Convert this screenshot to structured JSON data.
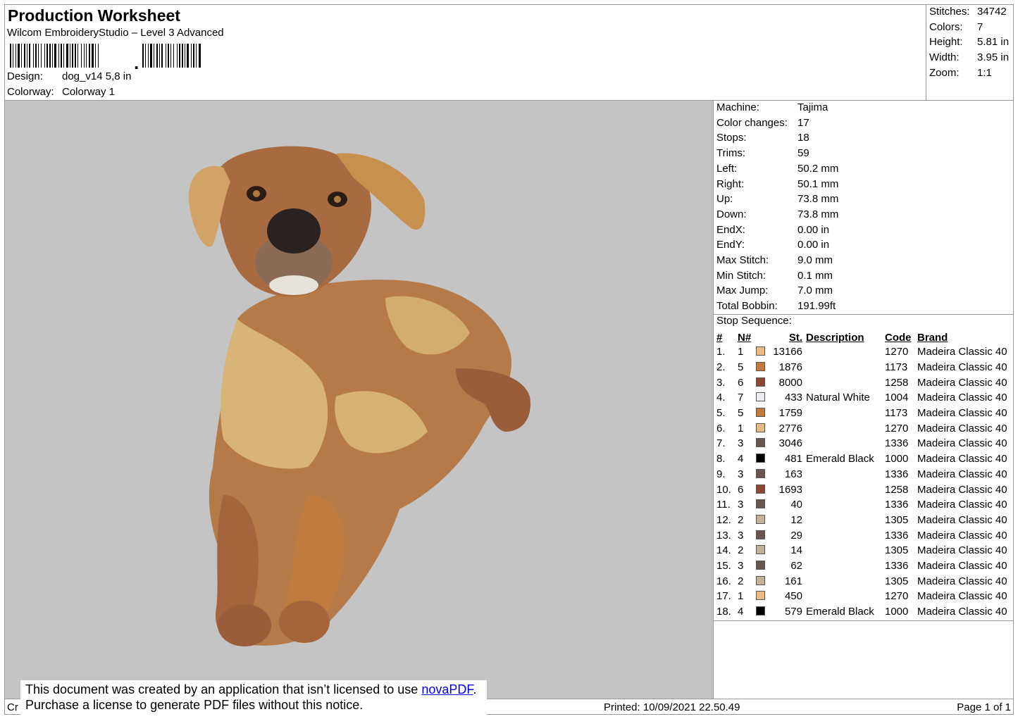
{
  "header": {
    "title": "Production Worksheet",
    "software": "Wilcom EmbroideryStudio – Level 3 Advanced",
    "barcode_digits": ",",
    "design_label": "Design:",
    "design_value": "dog_v14 5,8 in",
    "colorway_label": "Colorway:",
    "colorway_value": "Colorway 1"
  },
  "summary": {
    "stitches_label": "Stitches:",
    "stitches_value": "34742",
    "colors_label": "Colors:",
    "colors_value": "7",
    "height_label": "Height:",
    "height_value": "5.81 in",
    "width_label": "Width:",
    "width_value": "3.95 in",
    "zoom_label": "Zoom:",
    "zoom_value": "1:1"
  },
  "machine_info": [
    {
      "label": "Machine:",
      "value": "Tajima"
    },
    {
      "label": "Color changes:",
      "value": "17"
    },
    {
      "label": "Stops:",
      "value": "18"
    },
    {
      "label": "Trims:",
      "value": "59"
    },
    {
      "label": "Left:",
      "value": "50.2 mm"
    },
    {
      "label": "Right:",
      "value": "50.1 mm"
    },
    {
      "label": "Up:",
      "value": "73.8 mm"
    },
    {
      "label": "Down:",
      "value": "73.8 mm"
    },
    {
      "label": "EndX:",
      "value": "0.00 in"
    },
    {
      "label": "EndY:",
      "value": "0.00 in"
    },
    {
      "label": "Max Stitch:",
      "value": "9.0 mm"
    },
    {
      "label": "Min Stitch:",
      "value": "0.1 mm"
    },
    {
      "label": "Max Jump:",
      "value": "7.0 mm"
    },
    {
      "label": "Total Bobbin:",
      "value": "191.99ft"
    }
  ],
  "stop_sequence": {
    "title": "Stop Sequence:",
    "columns": [
      "#",
      "N#",
      "St.",
      "Description",
      "Code",
      "Brand"
    ],
    "rows": [
      {
        "idx": "1.",
        "n": "1",
        "color": "#e8b983",
        "st": "13166",
        "desc": "",
        "code": "1270",
        "brand": "Madeira Classic 40"
      },
      {
        "idx": "2.",
        "n": "5",
        "color": "#c07a3e",
        "st": "1876",
        "desc": "",
        "code": "1173",
        "brand": "Madeira Classic 40"
      },
      {
        "idx": "3.",
        "n": "6",
        "color": "#8a4a32",
        "st": "8000",
        "desc": "",
        "code": "1258",
        "brand": "Madeira Classic 40"
      },
      {
        "idx": "4.",
        "n": "7",
        "color": "#ecebf2",
        "st": "433",
        "desc": "Natural White",
        "code": "1004",
        "brand": "Madeira Classic 40"
      },
      {
        "idx": "5.",
        "n": "5",
        "color": "#c07a3e",
        "st": "1759",
        "desc": "",
        "code": "1173",
        "brand": "Madeira Classic 40"
      },
      {
        "idx": "6.",
        "n": "1",
        "color": "#e8b983",
        "st": "2776",
        "desc": "",
        "code": "1270",
        "brand": "Madeira Classic 40"
      },
      {
        "idx": "7.",
        "n": "3",
        "color": "#6b5550",
        "st": "3046",
        "desc": "",
        "code": "1336",
        "brand": "Madeira Classic 40"
      },
      {
        "idx": "8.",
        "n": "4",
        "color": "#000000",
        "st": "481",
        "desc": "Emerald Black",
        "code": "1000",
        "brand": "Madeira Classic 40"
      },
      {
        "idx": "9.",
        "n": "3",
        "color": "#6b5550",
        "st": "163",
        "desc": "",
        "code": "1336",
        "brand": "Madeira Classic 40"
      },
      {
        "idx": "10.",
        "n": "6",
        "color": "#8a4a32",
        "st": "1693",
        "desc": "",
        "code": "1258",
        "brand": "Madeira Classic 40"
      },
      {
        "idx": "11.",
        "n": "3",
        "color": "#6b5550",
        "st": "40",
        "desc": "",
        "code": "1336",
        "brand": "Madeira Classic 40"
      },
      {
        "idx": "12.",
        "n": "2",
        "color": "#c2b29a",
        "st": "12",
        "desc": "",
        "code": "1305",
        "brand": "Madeira Classic 40"
      },
      {
        "idx": "13.",
        "n": "3",
        "color": "#6b5550",
        "st": "29",
        "desc": "",
        "code": "1336",
        "brand": "Madeira Classic 40"
      },
      {
        "idx": "14.",
        "n": "2",
        "color": "#c2b29a",
        "st": "14",
        "desc": "",
        "code": "1305",
        "brand": "Madeira Classic 40"
      },
      {
        "idx": "15.",
        "n": "3",
        "color": "#6b5550",
        "st": "62",
        "desc": "",
        "code": "1336",
        "brand": "Madeira Classic 40"
      },
      {
        "idx": "16.",
        "n": "2",
        "color": "#c2b29a",
        "st": "161",
        "desc": "",
        "code": "1305",
        "brand": "Madeira Classic 40"
      },
      {
        "idx": "17.",
        "n": "1",
        "color": "#e8b983",
        "st": "450",
        "desc": "",
        "code": "1270",
        "brand": "Madeira Classic 40"
      },
      {
        "idx": "18.",
        "n": "4",
        "color": "#000000",
        "st": "579",
        "desc": "Emerald Black",
        "code": "1000",
        "brand": "Madeira Classic 40"
      }
    ]
  },
  "footer": {
    "left_text": "Cr",
    "printed": "Printed: 10/09/2021 22.50.49",
    "page": "Page 1 of 1"
  },
  "notice": {
    "line1_prefix": "This document was created by an application that isn’t licensed to use ",
    "link": "novaPDF",
    "line1_suffix": ".",
    "line2": "Purchase a license to generate PDF files without this notice."
  },
  "colors": {
    "preview_background": "#c4c4c4",
    "border": "#9a9a9a"
  }
}
